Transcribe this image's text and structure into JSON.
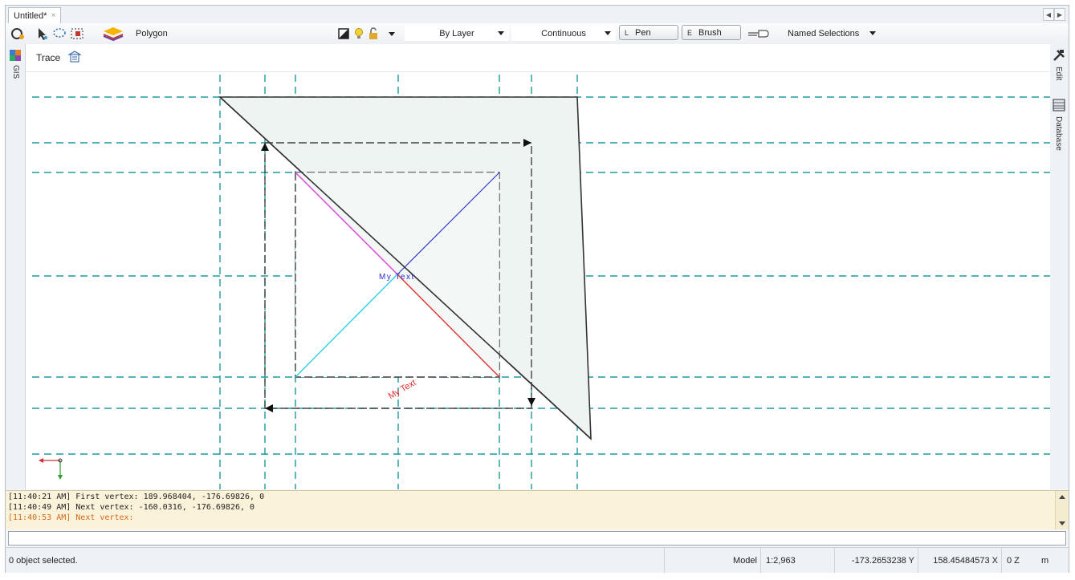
{
  "tab": {
    "title": "Untitled*",
    "close": "×"
  },
  "toolbar": {
    "layer_name": "Polygon",
    "color_style": "By Layer",
    "line_type": "Continuous",
    "pen_key": "L",
    "pen_label": "Pen",
    "brush_key": "E",
    "brush_label": "Brush",
    "named_selections": "Named Selections"
  },
  "left_panel": {
    "gis_label": "GIS"
  },
  "right_panel": {
    "edit_label": "Edit",
    "database_label": "Database"
  },
  "canvas": {
    "trace_label": "Trace",
    "text_horizontal": "My Text",
    "text_rotated": "My Text",
    "grid_color": "#1e9aa0"
  },
  "console": {
    "lines": [
      {
        "text": "[11:40:21 AM] First vertex: 189.968404, -176.69826, 0",
        "color": "#222222"
      },
      {
        "text": "[11:40:49 AM] Next vertex: -160.0316, -176.69826, 0",
        "color": "#222222"
      },
      {
        "text": "[11:40:53 AM] Next vertex:",
        "color": "#d2691e"
      }
    ]
  },
  "status": {
    "selection": "0 object selected.",
    "model": "Model",
    "scale": "1:2,963",
    "coord_y": "-173.2653238 Y",
    "coord_x": "158.45484573 X",
    "coord_z": "0 Z",
    "units": "m"
  }
}
